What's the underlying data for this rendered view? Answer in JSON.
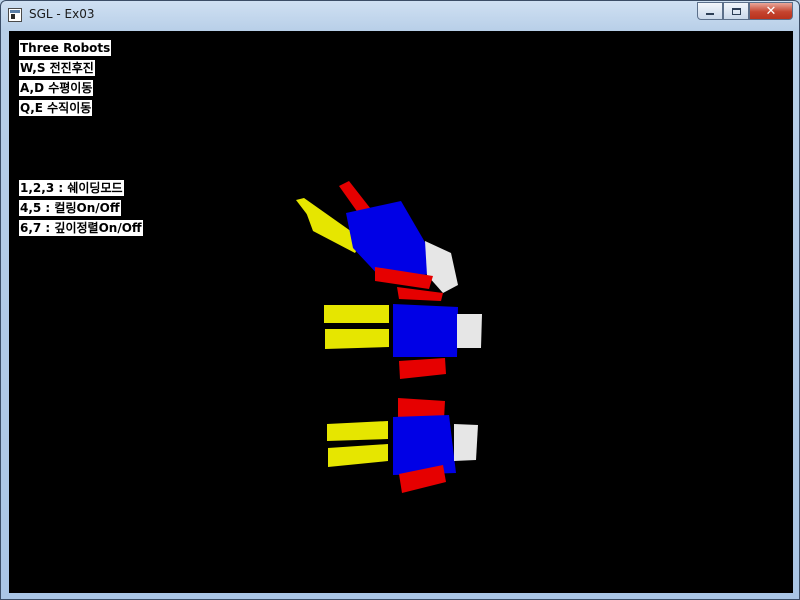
{
  "window": {
    "title": "SGL - Ex03",
    "controls": {
      "minimize": "minimize",
      "maximize": "maximize",
      "close": "✕"
    }
  },
  "hud": {
    "top_lines": [
      "Three Robots",
      "W,S 전진후진",
      "A,D 수평이동",
      "Q,E 수직이동"
    ],
    "bottom_lines": [
      "1,2,3 : 쉐이딩모드",
      "4,5 : 컬링On/Off",
      "6,7 : 깊이정렬On/Off"
    ]
  },
  "colors": {
    "background": "#000000",
    "robot_body": "#0000e6",
    "robot_red": "#e60000",
    "robot_yellow": "#e6e600",
    "robot_white": "#e6e6e6"
  },
  "scene": {
    "description_icon": "three-robots-3d-view"
  }
}
